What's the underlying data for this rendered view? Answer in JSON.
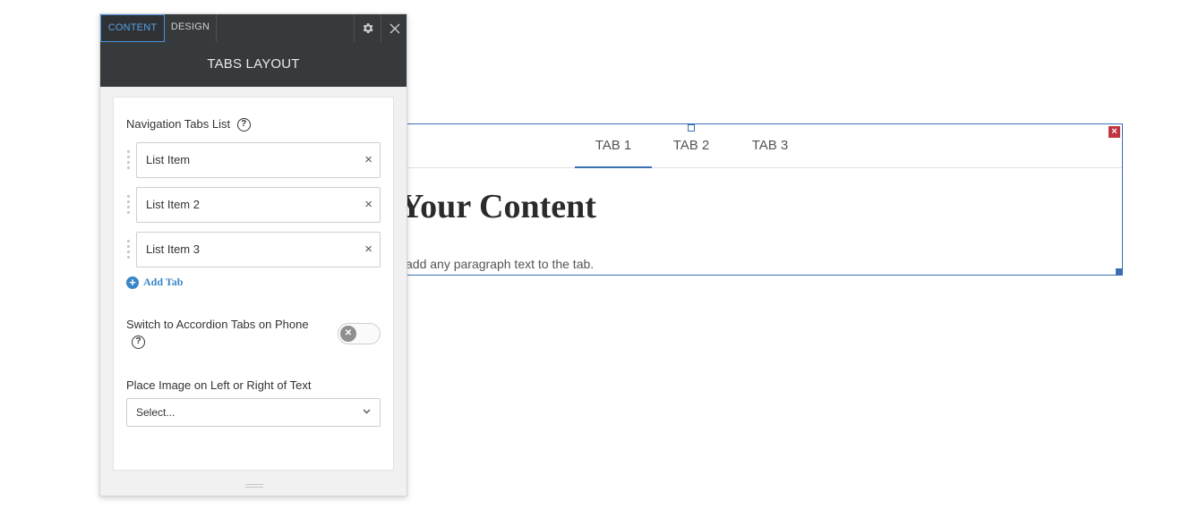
{
  "panel": {
    "tabs": {
      "content": "CONTENT",
      "design": "DESIGN"
    },
    "icons": {
      "settings": "gear-icon",
      "close": "close-icon"
    },
    "title": "TABS LAYOUT",
    "nav_label": "Navigation Tabs List",
    "help_glyph": "?",
    "list_items": [
      {
        "label": "List Item"
      },
      {
        "label": "List Item 2"
      },
      {
        "label": "List Item 3"
      }
    ],
    "remove_glyph": "×",
    "add_tab": "Add Tab",
    "add_glyph": "+",
    "accordion_label": "Switch to Accordion Tabs on Phone",
    "accordion_enabled": false,
    "image_position_label": "Place Image on Left or Right of Text",
    "select_value": "Select...",
    "accent_color": "#3a86c8",
    "header_color": "#373a3c"
  },
  "widget": {
    "tabs": [
      "TAB 1",
      "TAB 2",
      "TAB 3"
    ],
    "active_tab": "TAB 1",
    "heading": "e Your Content",
    "paragraph": "add any paragraph text to the tab.",
    "close_glyph": "×",
    "border_color": "#3a6fb3",
    "close_color": "#c0353f"
  }
}
